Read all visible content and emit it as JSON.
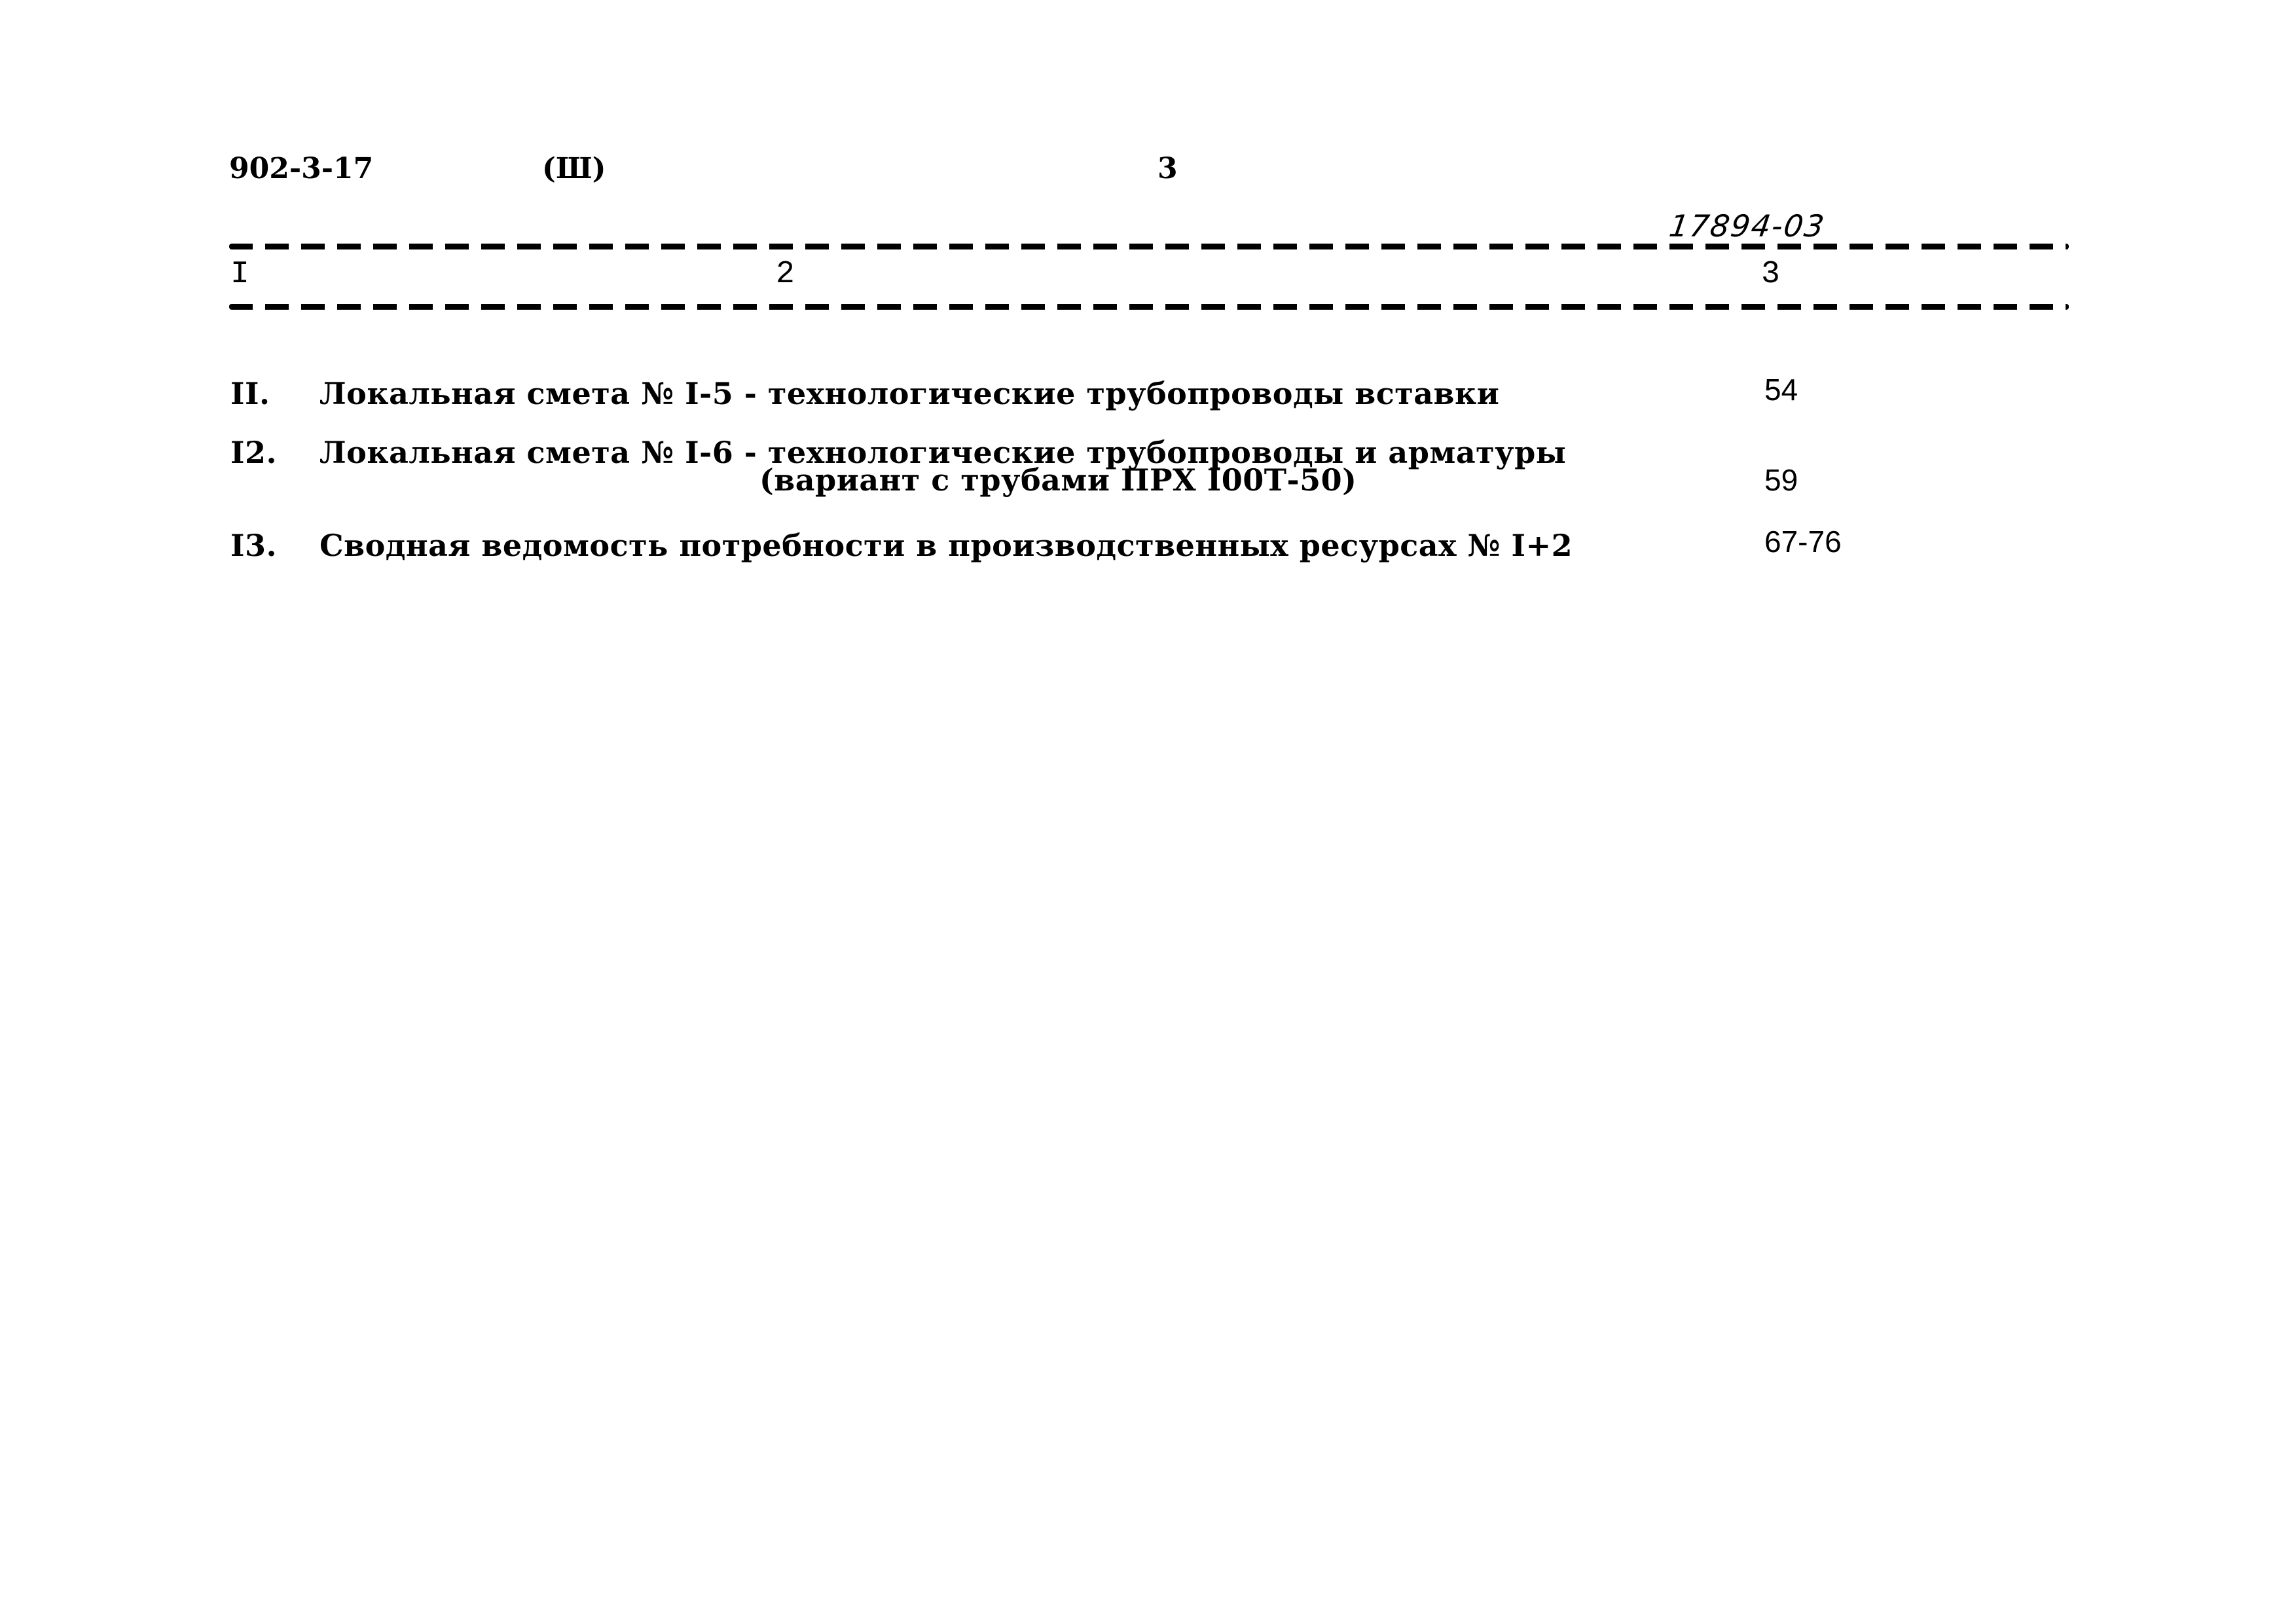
{
  "header": {
    "doc_code": "902-3-17",
    "part": "(Ш)",
    "page_number": "3",
    "handwritten_code": "17894-03"
  },
  "table": {
    "columns": [
      "I",
      "2",
      "3"
    ],
    "rows": [
      {
        "index": "II.",
        "lines": [
          "Локальная смета № I-5 - технологические трубопроводы вставки"
        ],
        "page": "54"
      },
      {
        "index": "I2.",
        "lines": [
          "Локальная смета № I-6 - технологические трубопроводы и арматуры",
          "(вариант с трубами ПРХ I00Т-50)"
        ],
        "page": "59"
      },
      {
        "index": "I3.",
        "lines": [
          "Сводная ведомость потребности в производственных ресурсах № I+2"
        ],
        "page": "67-76"
      }
    ]
  }
}
